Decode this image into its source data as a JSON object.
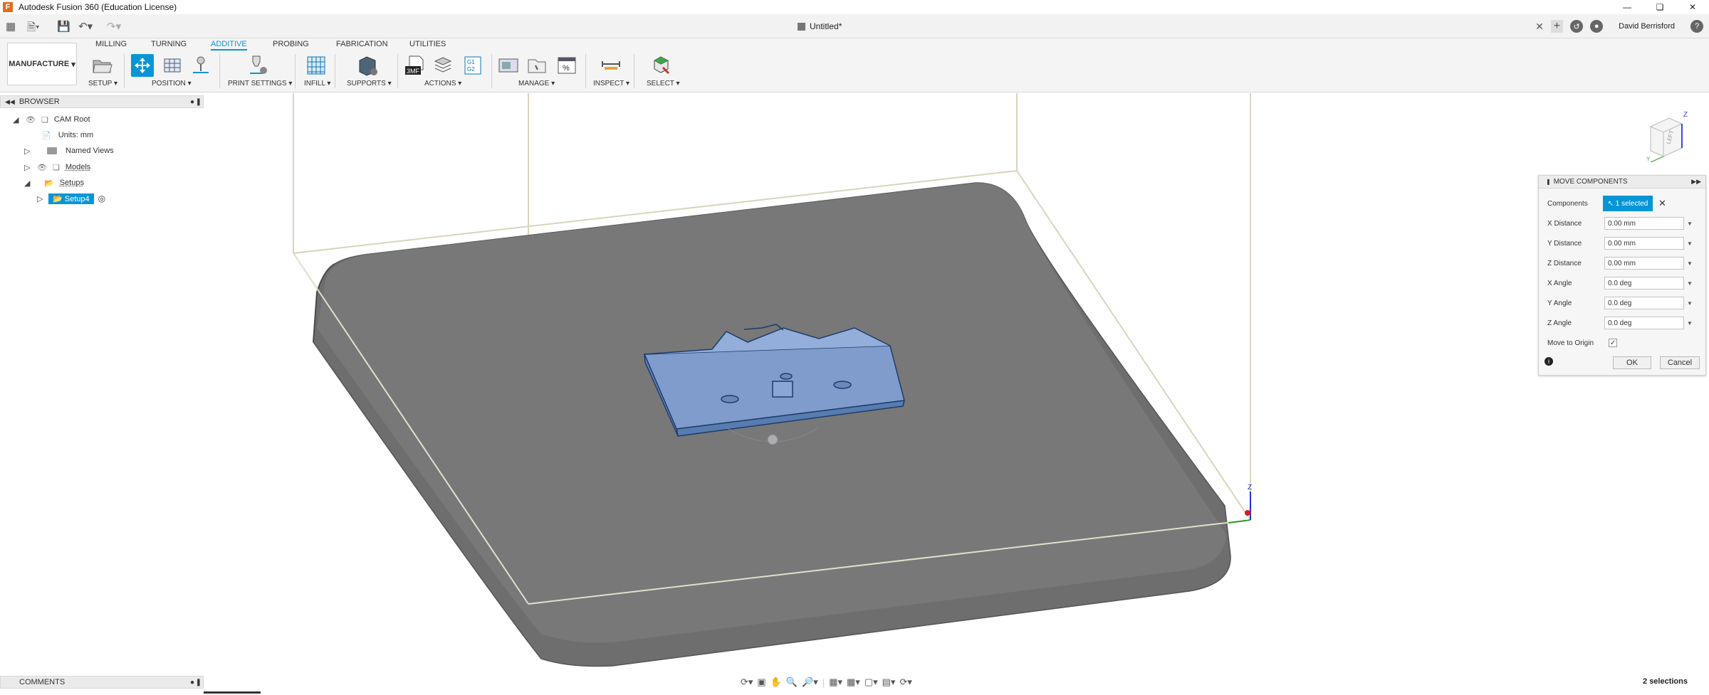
{
  "window": {
    "title": "Autodesk Fusion 360 (Education License)",
    "app_letter": "F"
  },
  "document": {
    "tab_title": "Untitled*",
    "user": "David Berrisford"
  },
  "ribbon": {
    "workspace": "MANUFACTURE",
    "tabs": [
      "MILLING",
      "TURNING",
      "ADDITIVE",
      "PROBING",
      "FABRICATION",
      "UTILITIES"
    ],
    "active_tab": "ADDITIVE",
    "groups": [
      "SETUP",
      "POSITION",
      "PRINT SETTINGS",
      "INFILL",
      "SUPPORTS",
      "ACTIONS",
      "MANAGE",
      "INSPECT",
      "SELECT"
    ],
    "icon_3mf": "3MF",
    "icon_g1g2": "G1 G2"
  },
  "browser": {
    "title": "BROWSER",
    "items": [
      {
        "label": "CAM Root"
      },
      {
        "label": "Units: mm"
      },
      {
        "label": "Named Views"
      },
      {
        "label": "Models"
      },
      {
        "label": "Setups"
      },
      {
        "label": "Setup4"
      }
    ]
  },
  "comments": {
    "title": "COMMENTS"
  },
  "move_dialog": {
    "title": "MOVE COMPONENTS",
    "components_label": "Components",
    "selected_text": "1 selected",
    "fields": [
      {
        "label": "X Distance",
        "value": "0.00 mm"
      },
      {
        "label": "Y Distance",
        "value": "0.00 mm"
      },
      {
        "label": "Z Distance",
        "value": "0.00 mm"
      },
      {
        "label": "X Angle",
        "value": "0.0 deg"
      },
      {
        "label": "Y Angle",
        "value": "0.0 deg"
      },
      {
        "label": "Z Angle",
        "value": "0.0 deg"
      }
    ],
    "move_to_origin_label": "Move to Origin",
    "ok": "OK",
    "cancel": "Cancel"
  },
  "viewcube": {
    "face": "LEFT",
    "axis_z": "Z",
    "axis_y": "Y"
  },
  "origin_axis_z": "Z",
  "status": {
    "selections": "2 selections"
  }
}
